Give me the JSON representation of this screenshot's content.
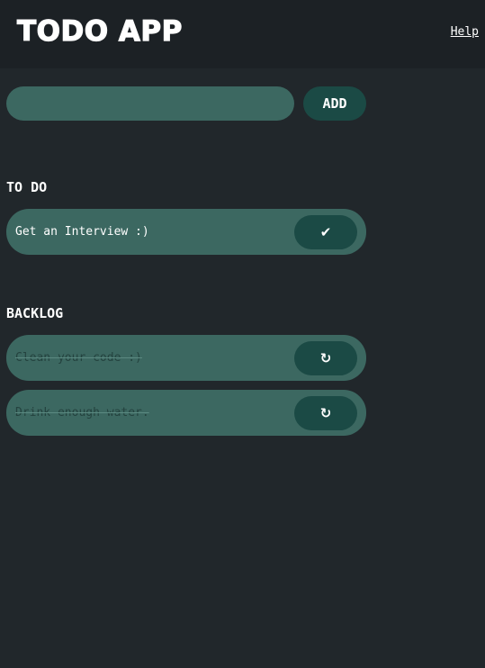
{
  "header": {
    "title": "TODO APP",
    "help_label": "Help"
  },
  "composer": {
    "input_value": "",
    "input_placeholder": "",
    "add_label": "ADD"
  },
  "todo": {
    "heading": "TO DO",
    "items": [
      {
        "text": "Get an Interview :)",
        "action_icon": "check-icon",
        "action_glyph": "✔"
      }
    ]
  },
  "backlog": {
    "heading": "BACKLOG",
    "items": [
      {
        "text": "Clean your code :)",
        "action_icon": "restore-icon",
        "action_glyph": "↻"
      },
      {
        "text": "Drink enough water.",
        "action_icon": "restore-icon",
        "action_glyph": "↻"
      }
    ]
  },
  "colors": {
    "background": "#21272b",
    "header_background": "#1c2125",
    "item_background": "#3c6861",
    "button_background": "#1b4a45",
    "done_text": "#24433f"
  }
}
